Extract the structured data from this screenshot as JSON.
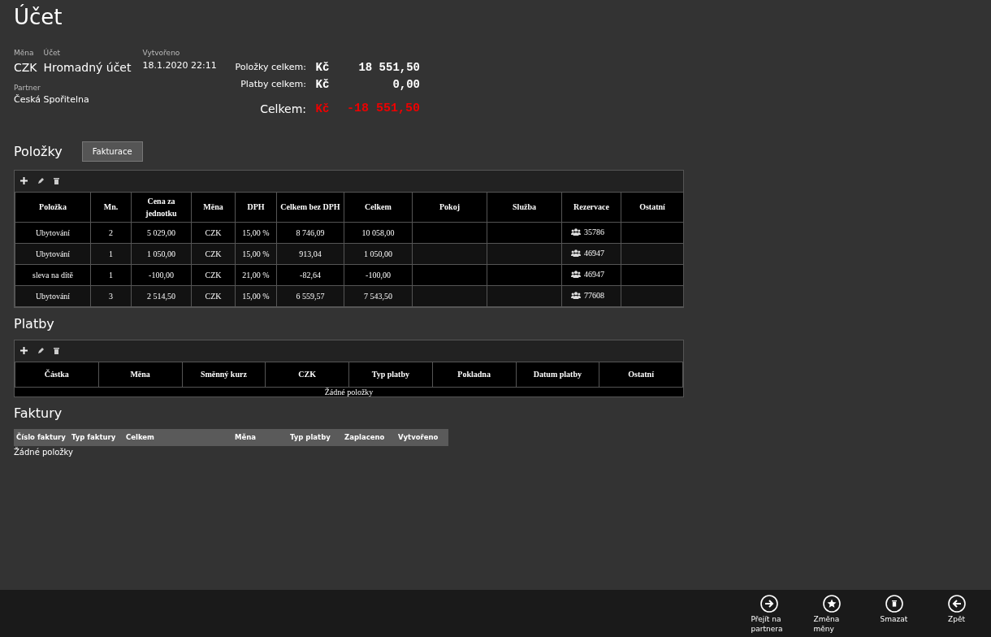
{
  "title": "Účet",
  "info": [
    {
      "label": "Měna",
      "value": "CZK",
      "kind": "large"
    },
    {
      "label": "Účet",
      "value": "Hromadný účet",
      "kind": "large"
    },
    {
      "label": "Vytvořeno",
      "value": "18.1.2020 22:11",
      "kind": "small"
    }
  ],
  "partner": {
    "label": "Partner",
    "value": "Česká Spořitelna"
  },
  "totals": [
    {
      "label": "Položky celkem:",
      "currency": "Kč",
      "amount": "18 551,50",
      "kind": "line"
    },
    {
      "label": "Platby celkem:",
      "currency": "Kč",
      "amount": "0,00",
      "kind": "line"
    },
    {
      "label": "Celkem:",
      "currency": "Kč",
      "amount": "-18 551,50",
      "kind": "grand"
    }
  ],
  "items": {
    "heading": "Položky",
    "button": "Fakturace",
    "columns": [
      {
        "label": "Položka",
        "kind": "text"
      },
      {
        "label": "Mn.",
        "kind": "text"
      },
      {
        "label": "Cena za jednotku",
        "kind": "text"
      },
      {
        "label": "Měna",
        "kind": "text"
      },
      {
        "label": "DPH",
        "kind": "text"
      },
      {
        "label": "Celkem bez DPH",
        "kind": "text"
      },
      {
        "label": "Celkem",
        "kind": "text"
      },
      {
        "label": "Pokoj",
        "kind": "text"
      },
      {
        "label": "Služba",
        "kind": "text"
      },
      {
        "label": "Rezervace",
        "kind": "reservation"
      },
      {
        "label": "Ostatní",
        "kind": "text"
      }
    ],
    "rows": [
      [
        "Ubytování",
        "2",
        "5 029,00",
        "CZK",
        "15,00 %",
        "8 746,09",
        "10 058,00",
        "",
        "",
        "35786",
        ""
      ],
      [
        "Ubytování",
        "1",
        "1 050,00",
        "CZK",
        "15,00 %",
        "913,04",
        "1 050,00",
        "",
        "",
        "46947",
        ""
      ],
      [
        "sleva na dítě",
        "1",
        "-100,00",
        "CZK",
        "21,00 %",
        "-82,64",
        "-100,00",
        "",
        "",
        "46947",
        ""
      ],
      [
        "Ubytování",
        "3",
        "2 514,50",
        "CZK",
        "15,00 %",
        "6 559,57",
        "7 543,50",
        "",
        "",
        "77608",
        ""
      ]
    ]
  },
  "payments": {
    "heading": "Platby",
    "columns": [
      "Částka",
      "Měna",
      "Směnný kurz",
      "CZK",
      "Typ platby",
      "Pokladna",
      "Datum platby",
      "Ostatní"
    ],
    "empty": "Žádné položky"
  },
  "invoices": {
    "heading": "Faktury",
    "columns": [
      "Číslo faktury",
      "Typ faktury",
      "Celkem",
      "Měna",
      "Typ platby",
      "Zaplaceno",
      "Vytvořeno"
    ],
    "empty": "Žádné položky"
  },
  "appbar": [
    {
      "label": "Přejít na partnera",
      "kind": "forward"
    },
    {
      "label": "Změna měny",
      "kind": "star"
    },
    {
      "label": "Smazat",
      "kind": "trash"
    },
    {
      "label": "Zpět",
      "kind": "back"
    }
  ]
}
